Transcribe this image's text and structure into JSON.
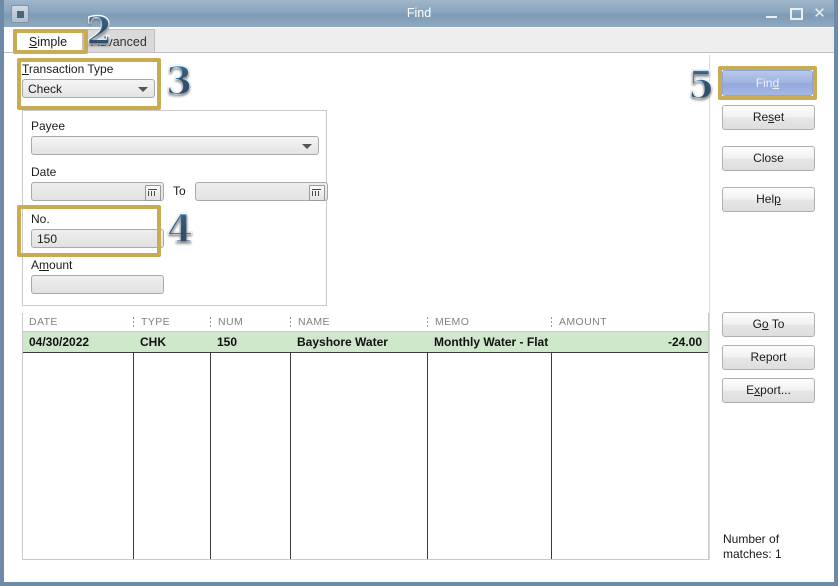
{
  "window": {
    "title": "Find",
    "sysmenu_icon": "system-menu-icon",
    "minimize_icon": "minimize-icon",
    "maximize_icon": "maximize-icon",
    "close_icon": "close-icon"
  },
  "tabs": [
    {
      "label": "Simple",
      "active": true
    },
    {
      "label": "Advanced",
      "active": false
    }
  ],
  "form": {
    "transaction_type": {
      "label_pre": "T",
      "label_post": "ransaction Type",
      "value": "Check",
      "arrow_icon": "chevron-down-icon"
    },
    "payee": {
      "label": "Payee",
      "value": "",
      "arrow_icon": "chevron-down-icon"
    },
    "date": {
      "label": "Date",
      "from_value": "",
      "to_label": "To",
      "to_value": "",
      "calendar_icon": "calendar-icon"
    },
    "no": {
      "label": "No.",
      "value": "150"
    },
    "amount": {
      "label_pre": "A",
      "label_mid": "m",
      "label_post": "ount",
      "value": ""
    }
  },
  "buttons": {
    "find_pre": "Fin",
    "find_mid": "d",
    "reset_pre": "Re",
    "reset_mid": "s",
    "reset_post": "et",
    "close": "Close",
    "help_pre": "Hel",
    "help_mid": "p",
    "goto_pre": "G",
    "goto_mid": "o",
    "goto_post": " To",
    "report": "Report",
    "export_pre": "E",
    "export_mid": "x",
    "export_post": "port..."
  },
  "results": {
    "columns": [
      "DATE",
      "TYPE",
      "NUM",
      "NAME",
      "MEMO",
      "AMOUNT"
    ],
    "rows": [
      {
        "date": "04/30/2022",
        "type": "CHK",
        "num": "150",
        "name": "Bayshore Water",
        "memo": "Monthly Water - Flat ...",
        "amount": "-24.00"
      }
    ],
    "matches_line1": "Number of",
    "matches_line2": "matches: 1"
  },
  "annotations": {
    "callouts": [
      "2",
      "3",
      "4",
      "5"
    ],
    "highlight_color": "#c8ab52",
    "numeral_color": "#1f6cb0",
    "selected_row_color": "#cfe7cb"
  }
}
